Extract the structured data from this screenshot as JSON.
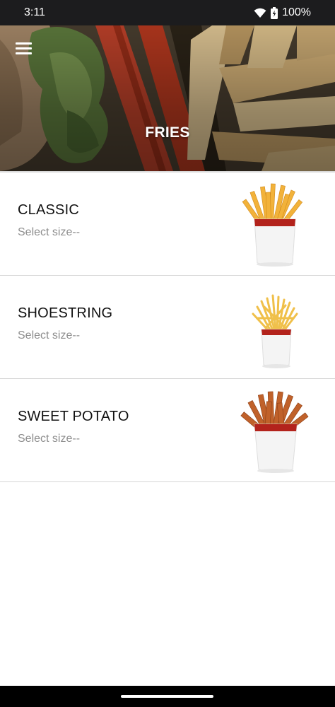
{
  "status": {
    "time": "3:11",
    "battery": "100%"
  },
  "header": {
    "title": "FRIES",
    "menu_icon": "hamburger-menu-icon"
  },
  "items": [
    {
      "name": "CLASSIC",
      "subtitle": "Select size--",
      "image": "classic-fries-cup"
    },
    {
      "name": "SHOESTRING",
      "subtitle": "Select size--",
      "image": "shoestring-fries-cup"
    },
    {
      "name": "SWEET POTATO",
      "subtitle": "Select size--",
      "image": "sweet-potato-fries-cup"
    }
  ],
  "colors": {
    "status_bar": "#1c1c1e",
    "cup_band": "#b3231c",
    "fries_gold": "#f2b23a",
    "sweet_potato": "#c0612a"
  }
}
